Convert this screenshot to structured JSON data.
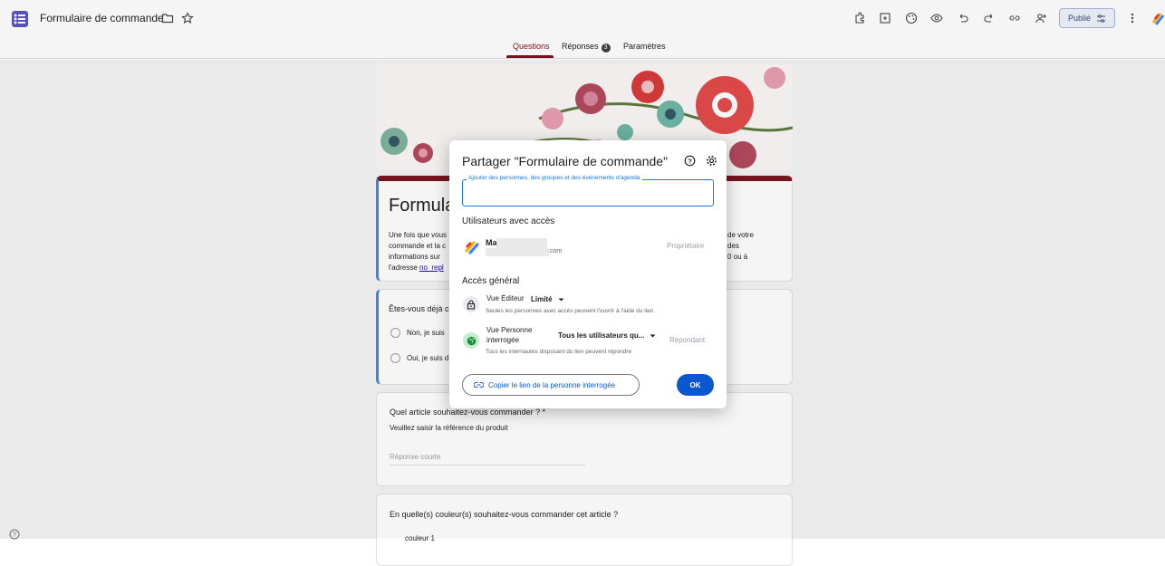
{
  "app": {
    "doc_title": "Formulaire de commande",
    "publish_label": "Publié"
  },
  "tabs": [
    {
      "label": "Questions"
    },
    {
      "label": "Réponses",
      "badge": "3"
    },
    {
      "label": "Paramètres"
    }
  ],
  "form_background": {
    "header_title": "Formula",
    "description_lines_left": [
      "Une fois que vous",
      "commande et la c",
      "informations sur",
      "l'adresse"
    ],
    "description_link": "no_repl",
    "description_lines_right": [
      "de votre",
      "des",
      "0 ou à"
    ],
    "question1": {
      "title": "Êtes-vous déjà c",
      "options": [
        "Non, je suis",
        "Oui, je suis d"
      ]
    },
    "question2": {
      "title": "Quel article souhaitez-vous commander ? *",
      "description": "Veuillez saisir la référence du produit",
      "placeholder": "Réponse courte"
    },
    "question3": {
      "title": "En quelle(s) couleur(s) souhaitez-vous commander cet article ?",
      "option1": "couleur 1"
    }
  },
  "share_dialog": {
    "title": "Partager \"Formulaire de commande\"",
    "add_people_label": "Ajouter des personnes, des groupes et des événements d'agenda",
    "users_section_title": "Utilisateurs avec accès",
    "user": {
      "name": "Marie N",
      "email_suffix": ".com",
      "role": "Propriétaire"
    },
    "general_access_title": "Accès général",
    "editor_access": {
      "label": "Vue Éditeur",
      "value": "Limité",
      "description": "Seules les personnes avec accès peuvent l'ouvrir à l'aide du lien"
    },
    "respondent_access": {
      "label_line1": "Vue Personne",
      "label_line2": "interrogée",
      "value": "Tous les utilisateurs qu...",
      "role": "Répondant",
      "description": "Tous les internautes disposant du lien peuvent répondre"
    },
    "copy_link_label": "Copier le lien de la personne interrogée",
    "ok_label": "OK"
  },
  "colors": {
    "accent": "#7a1420",
    "primary_blue": "#0b57d0",
    "green_globe": "#1e8e3e"
  }
}
